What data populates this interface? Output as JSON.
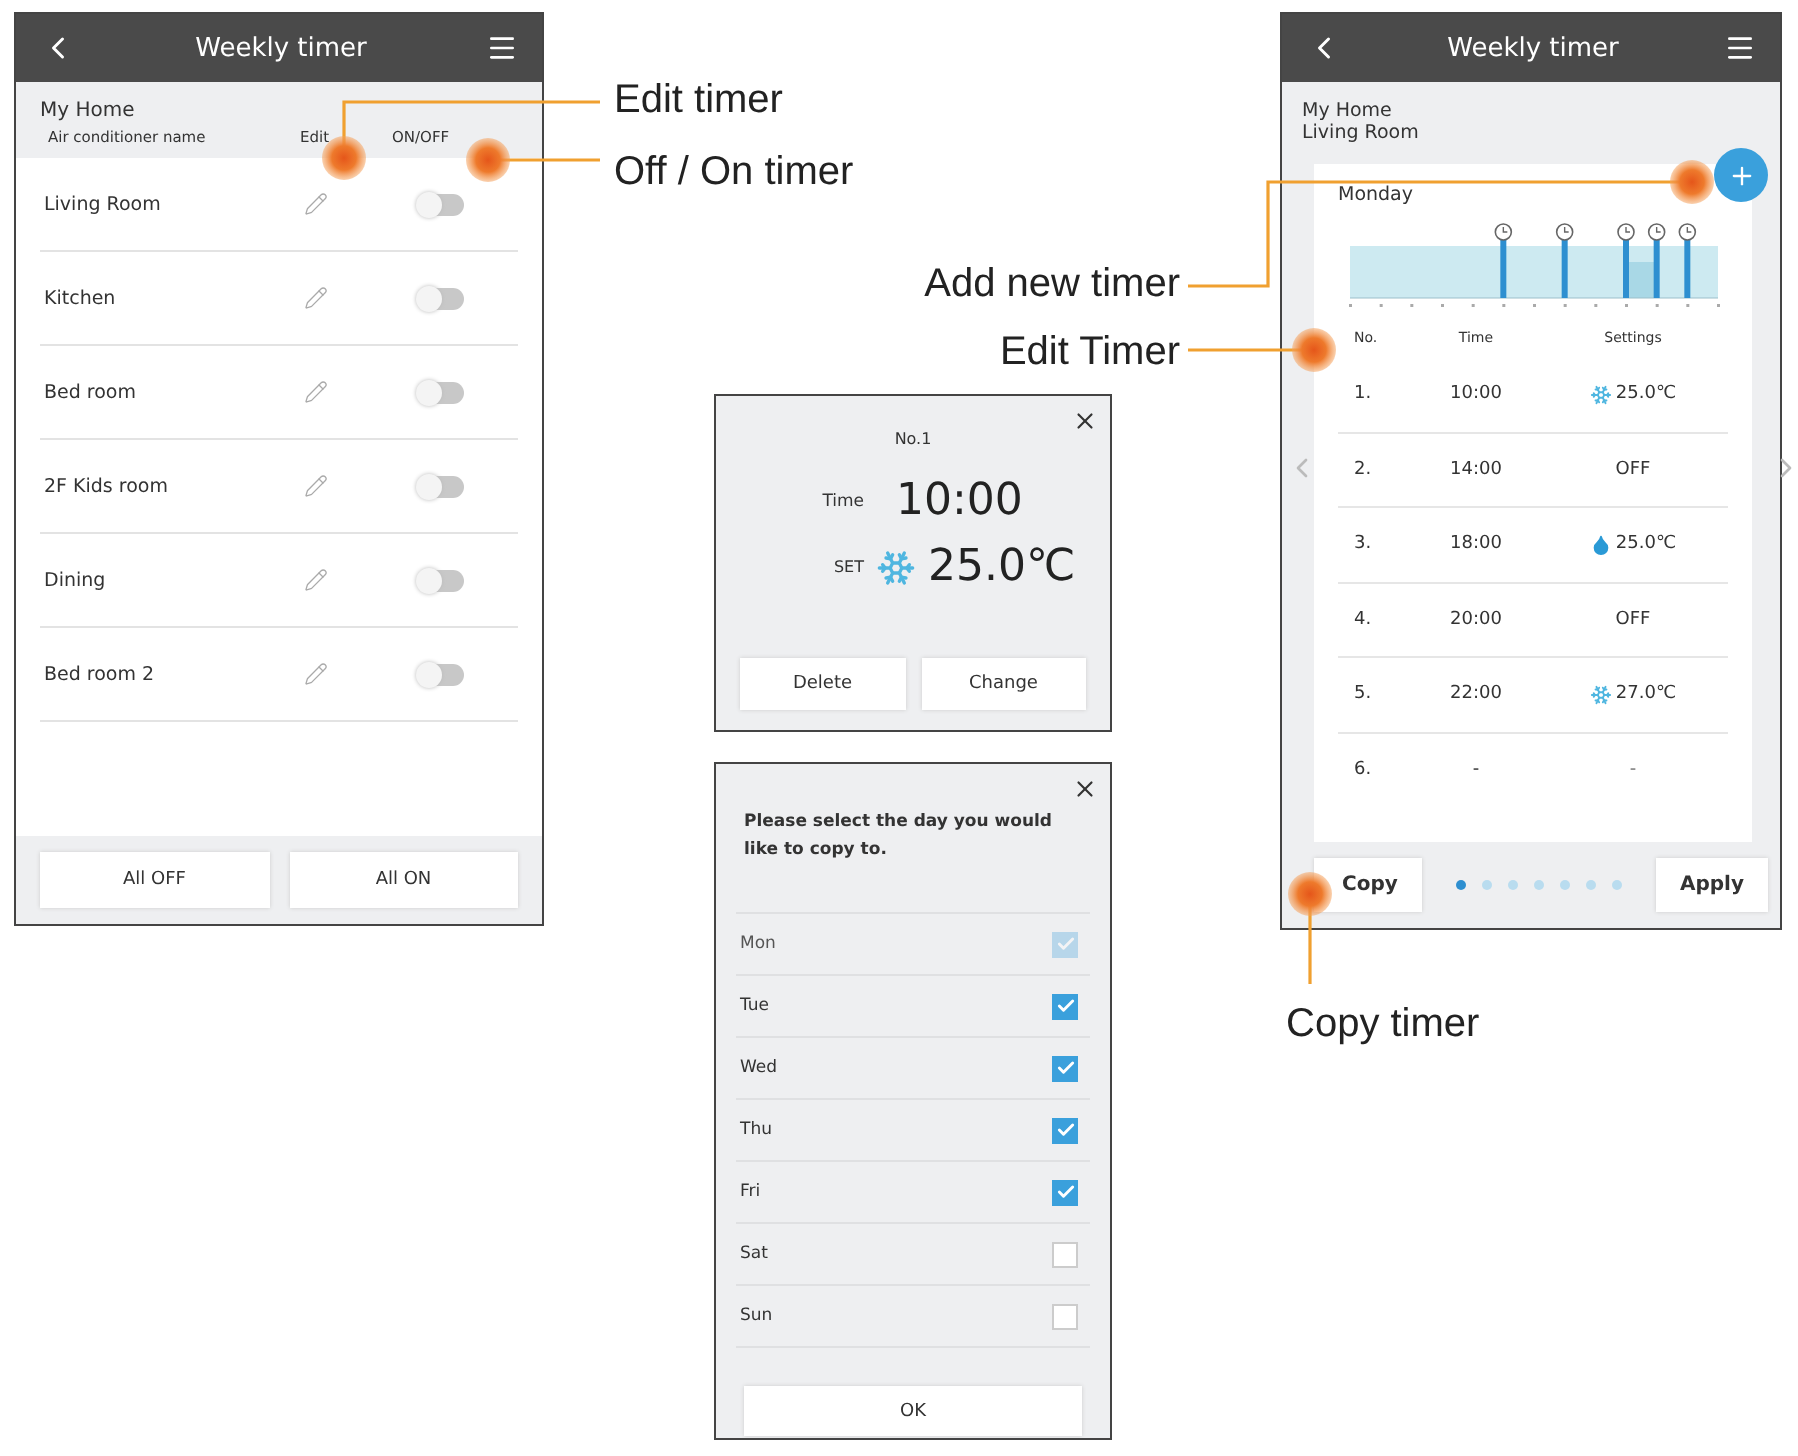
{
  "timer_list": {
    "title": "Weekly timer",
    "home": "My Home",
    "columns": [
      "Air conditioner name",
      "Edit",
      "ON/OFF"
    ],
    "rooms": [
      {
        "name": "Living Room",
        "on": false
      },
      {
        "name": "Kitchen",
        "on": false
      },
      {
        "name": "Bed room",
        "on": false
      },
      {
        "name": "2F Kids room",
        "on": false
      },
      {
        "name": "Dining",
        "on": false
      },
      {
        "name": "Bed room 2",
        "on": false
      }
    ],
    "buttons": [
      "All OFF",
      "All ON"
    ]
  },
  "timer_detail_dialog": {
    "heading": "No.1",
    "time_label": "Time",
    "time": "10:00",
    "set_label": "SET",
    "kind": "cool",
    "temperature": "25.0℃",
    "buttons": [
      "Delete",
      "Change"
    ]
  },
  "copy_dialog": {
    "message": "Please select the day you would like to copy to.",
    "days": [
      {
        "label": "Mon",
        "checked": true,
        "disabled": true
      },
      {
        "label": "Tue",
        "checked": true,
        "disabled": false
      },
      {
        "label": "Wed",
        "checked": true,
        "disabled": false
      },
      {
        "label": "Thu",
        "checked": true,
        "disabled": false
      },
      {
        "label": "Fri",
        "checked": true,
        "disabled": false
      },
      {
        "label": "Sat",
        "checked": false,
        "disabled": false
      },
      {
        "label": "Sun",
        "checked": false,
        "disabled": false
      }
    ],
    "button": "OK"
  },
  "weekly_timer": {
    "title": "Weekly timer",
    "home": "My Home",
    "room": "Living Room",
    "day": "Monday",
    "columns": [
      "No.",
      "Time",
      "Settings"
    ],
    "timers": [
      {
        "number": "1.",
        "time": "10:00",
        "kind": "cool",
        "setting": "25.0℃"
      },
      {
        "number": "2.",
        "time": "14:00",
        "kind": "off",
        "setting": "OFF"
      },
      {
        "number": "3.",
        "time": "18:00",
        "kind": "dry",
        "setting": "25.0℃"
      },
      {
        "number": "4.",
        "time": "20:00",
        "kind": "off",
        "setting": "OFF"
      },
      {
        "number": "5.",
        "time": "22:00",
        "kind": "cool",
        "setting": "27.0℃"
      },
      {
        "number": "6.",
        "time": "-",
        "kind": "empty",
        "setting": "-"
      }
    ],
    "copy_button": "Copy",
    "apply_button": "Apply",
    "pages": [
      {
        "selected": true
      },
      {
        "selected": false
      },
      {
        "selected": false
      },
      {
        "selected": false
      },
      {
        "selected": false
      },
      {
        "selected": false
      },
      {
        "selected": false
      }
    ]
  },
  "callouts": [
    {
      "label": "Edit timer"
    },
    {
      "label": "Off / On timer"
    },
    {
      "label": "Add new timer"
    },
    {
      "label": "Edit Timer"
    },
    {
      "label": "Copy timer"
    }
  ]
}
